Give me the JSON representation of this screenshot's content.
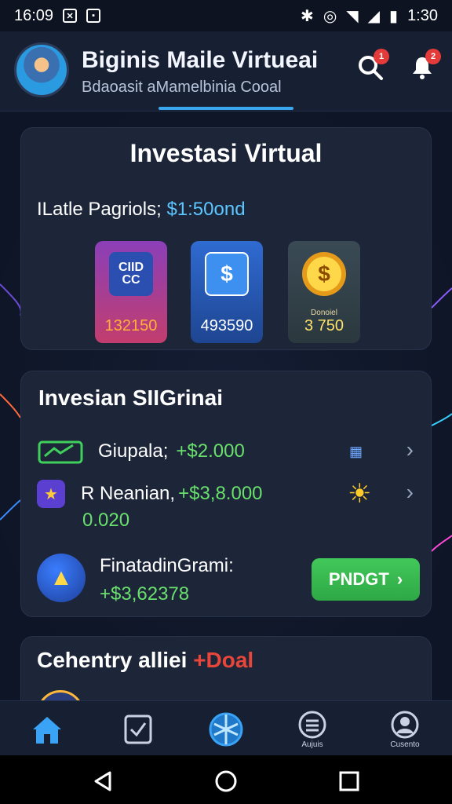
{
  "statusbar": {
    "time_left": "16:09",
    "icon_left_1": "x-box-icon",
    "icon_left_2": "square-icon",
    "time_right": "1:30"
  },
  "header": {
    "title": "Biginis Maile Virtueai",
    "subtitle": "Bdaoasit aMamelbinia Cooal",
    "search_badge": "1",
    "notification_badge": "2"
  },
  "card1": {
    "title": "Investasi Virtual",
    "line_label": "ILatle Pagriols;",
    "line_amount": "$1:50ond",
    "tiles": [
      {
        "icon_text": "C||▮\nCC",
        "caption": "",
        "value": "132150",
        "value_color": "#ffb13a"
      },
      {
        "icon_text": "$",
        "caption": "",
        "value": "493590",
        "value_color": "#ffffff"
      },
      {
        "icon_text": "$",
        "caption": "Donoiel",
        "value": "3 750",
        "value_color": "#ffe26a"
      }
    ]
  },
  "card2": {
    "title": "Invesian SIIGrinai",
    "rows": [
      {
        "label": "Giupala;",
        "amount": "+$2.000"
      },
      {
        "label": "R Neanian,",
        "amount": "+$3,8.000"
      },
      {
        "label": "",
        "amount": "0.020"
      }
    ],
    "final_label": "FinatadinGrami:",
    "final_amount": "+$3,62378",
    "proceed_label": "PNDGT"
  },
  "card3": {
    "title_main": "Cehentry alliei",
    "title_red": "+Doal"
  },
  "bottomnav": {
    "labels": [
      "",
      "",
      "",
      "Aujuis",
      "Cusento"
    ]
  },
  "colors": {
    "accent_blue": "#39a7ef",
    "positive_green": "#69e06c",
    "button_green": "#2ea845",
    "badge_red": "#e43a3a"
  }
}
